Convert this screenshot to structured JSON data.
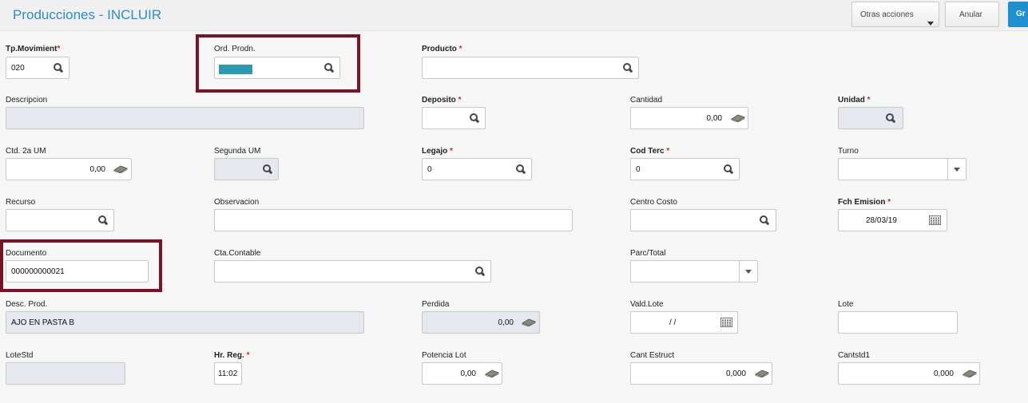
{
  "header": {
    "title": "Producciones - INCLUIR",
    "other_actions_label": "Otras acciones",
    "cancel_label": "Anular",
    "primary_label": "Gr"
  },
  "fields": {
    "tp_movimiento": {
      "label": "Tp.Movimient",
      "required": "*",
      "value": "020"
    },
    "ord_prodn": {
      "label": "Ord. Prodn.",
      "value": ""
    },
    "producto": {
      "label": "Producto",
      "required": "*",
      "value": ""
    },
    "descripcion": {
      "label": "Descripcion",
      "value": ""
    },
    "deposito": {
      "label": "Deposito",
      "required": "*",
      "value": ""
    },
    "cantidad": {
      "label": "Cantidad",
      "value": "0,00"
    },
    "unidad": {
      "label": "Unidad",
      "required": "*",
      "value": ""
    },
    "ctd_2a_um": {
      "label": "Ctd. 2a UM",
      "value": "0,00"
    },
    "segunda_um": {
      "label": "Segunda UM",
      "value": ""
    },
    "legajo": {
      "label": "Legajo",
      "required": "*",
      "value": "0"
    },
    "cod_terc": {
      "label": "Cod Terc",
      "required": "*",
      "value": "0"
    },
    "turno": {
      "label": "Turno",
      "value": ""
    },
    "recurso": {
      "label": "Recurso",
      "value": ""
    },
    "observacion": {
      "label": "Observacion",
      "value": ""
    },
    "centro_costo": {
      "label": "Centro Costo",
      "value": ""
    },
    "fch_emision": {
      "label": "Fch Emision",
      "required": "*",
      "value": "28/03/19"
    },
    "documento": {
      "label": "Documento",
      "value": "000000000021"
    },
    "cta_contable": {
      "label": "Cta.Contable",
      "value": ""
    },
    "parc_total": {
      "label": "Parc/Total",
      "value": ""
    },
    "desc_prod": {
      "label": "Desc. Prod.",
      "value": "AJO EN PASTA B"
    },
    "perdida": {
      "label": "Perdida",
      "value": "0,00"
    },
    "vald_lote": {
      "label": "Vald.Lote",
      "value": "/ /"
    },
    "lote": {
      "label": "Lote",
      "value": ""
    },
    "lote_std": {
      "label": "LoteStd",
      "value": ""
    },
    "hr_reg": {
      "label": "Hr. Reg.",
      "required": "*",
      "value": "11:02"
    },
    "potencia_lot": {
      "label": "Potencia Lot",
      "value": "0,00"
    },
    "cant_estruct": {
      "label": "Cant Estruct",
      "value": "0,000"
    },
    "cantstd1": {
      "label": "Cantstd1",
      "value": "0,000"
    }
  },
  "colors": {
    "accent": "#2a8ec9",
    "primary": "#1e8fd0",
    "highlight": "#7a1126",
    "readonly": "#e6e8ef",
    "selected": "#2b9bb0"
  },
  "icons": [
    "search-icon",
    "money-icon",
    "calendar-icon",
    "chevron-down-icon"
  ]
}
